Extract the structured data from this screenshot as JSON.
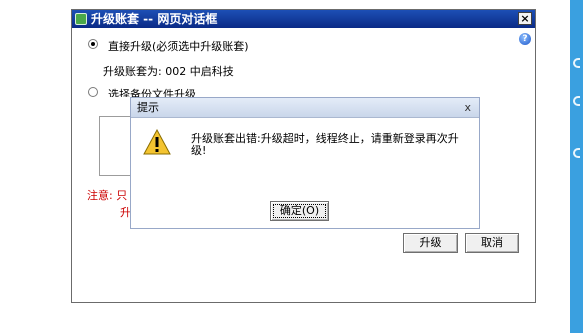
{
  "outer_dialog": {
    "title": "升级账套 -- 网页对话框",
    "close_label": "×",
    "help_label": "?",
    "option_direct_label": "直接升级(必须选中升级账套)",
    "account_line": "升级账套为: 002 中启科技",
    "option_backup_label": "选择备份文件升级",
    "note_label": "注意: 只",
    "note_line2": "升",
    "upgrade_button": "升级",
    "cancel_button": "取消"
  },
  "modal": {
    "title": "提示",
    "close_label": "x",
    "message": "升级账套出错:升级超时，线程终止，请重新登录再次升级!",
    "ok_button": "确定(O)"
  },
  "colors": {
    "titlebar": "#0a2a86",
    "note_text": "#cc0000",
    "sidebar_strip": "#3aa0e0"
  },
  "icons": [
    "app-icon",
    "close-icon",
    "help-icon",
    "warning-icon"
  ]
}
